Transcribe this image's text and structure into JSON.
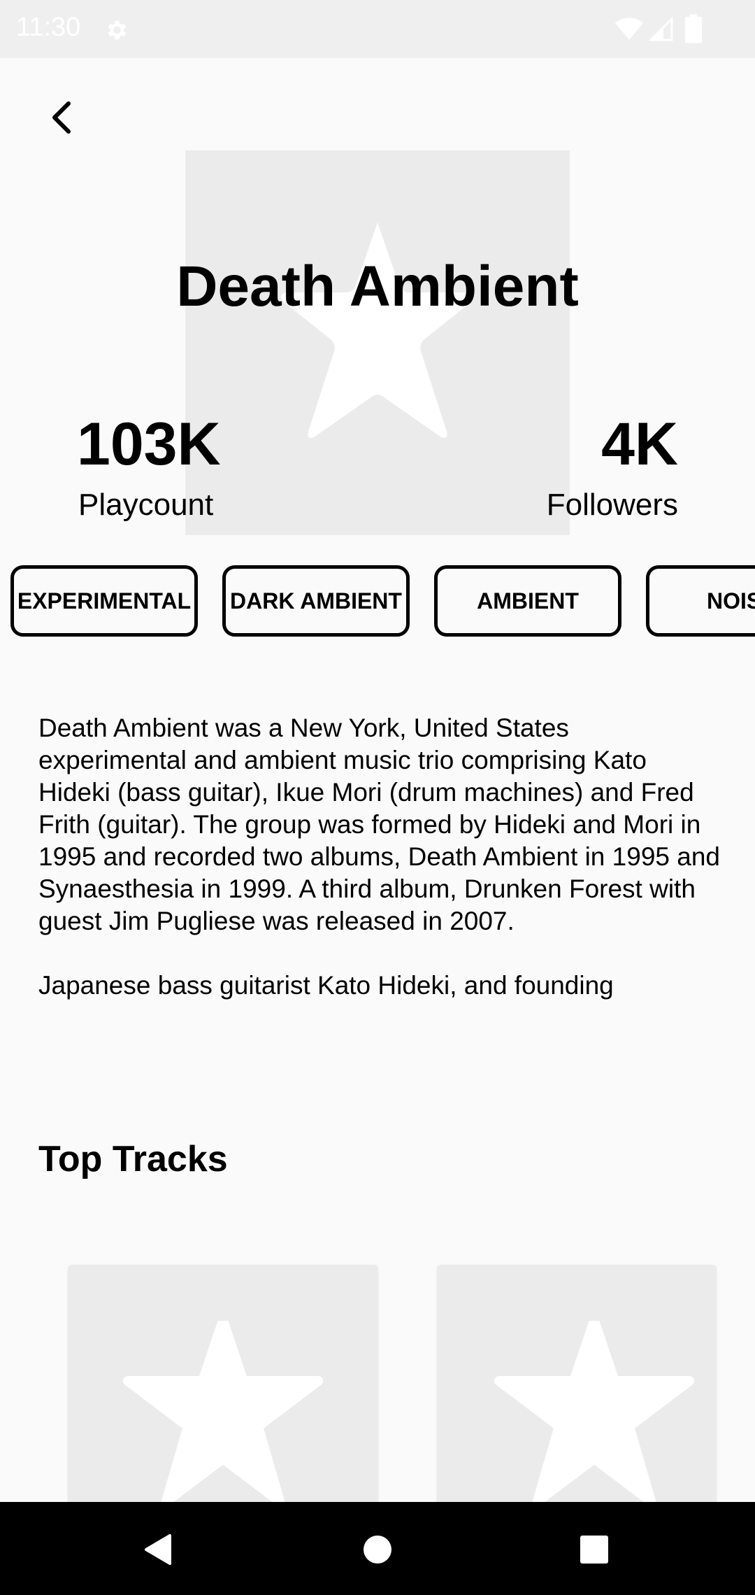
{
  "status_bar": {
    "time": "11:30",
    "icons": [
      "settings-gear-icon",
      "wifi-icon",
      "cell-signal-icon",
      "battery-icon"
    ]
  },
  "header": {
    "back_icon": "chevron-left-icon"
  },
  "artist": {
    "name": "Death Ambient",
    "image_placeholder_icon": "star-icon"
  },
  "stats": {
    "playcount": {
      "value": "103K",
      "label": "Playcount"
    },
    "followers": {
      "value": "4K",
      "label": "Followers"
    }
  },
  "tags": [
    {
      "label": "EXPERIMENTAL"
    },
    {
      "label": "DARK AMBIENT"
    },
    {
      "label": "AMBIENT"
    },
    {
      "label": "NOISE"
    }
  ],
  "bio": {
    "paragraph_1": "Death Ambient was a New York, United States experimental and ambient music trio comprising Kato Hideki (bass guitar), Ikue Mori (drum machines) and Fred Frith (guitar). The group was formed by Hideki and Mori in 1995 and recorded two albums, Death Ambient in 1995 and Synaesthesia in 1999. A third album, Drunken Forest with guest Jim Pugliese was released in 2007.",
    "paragraph_2": "Japanese bass guitarist Kato Hideki, and founding"
  },
  "top_tracks": {
    "title": "Top Tracks",
    "cards": [
      {
        "placeholder_icon": "star-icon"
      },
      {
        "placeholder_icon": "star-icon"
      }
    ]
  },
  "nav_bar": {
    "back_icon": "triangle-back-icon",
    "home_icon": "circle-home-icon",
    "recents_icon": "square-recents-icon"
  },
  "colors": {
    "background": "#fafafa",
    "status_bar": "#efefef",
    "placeholder": "#ebebeb",
    "text": "#000000",
    "nav_bar": "#000000"
  }
}
